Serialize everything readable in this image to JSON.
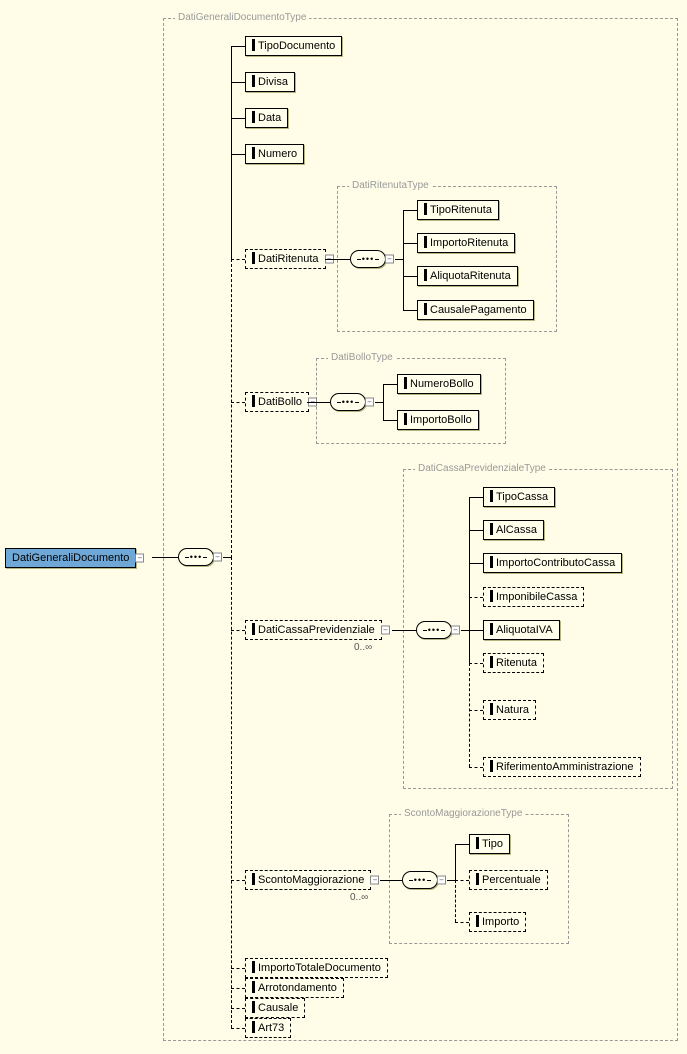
{
  "root": {
    "label": "DatiGeneraliDocumento"
  },
  "type_labels": {
    "main": "DatiGeneraliDocumentoType",
    "ritenuta": "DatiRitenutaType",
    "bollo": "DatiBolloType",
    "cassa": "DatiCassaPrevidenzialeType",
    "sconto": "ScontoMaggiorazioneType"
  },
  "children": {
    "tipoDocumento": "TipoDocumento",
    "divisa": "Divisa",
    "data": "Data",
    "numero": "Numero",
    "datiRitenuta": "DatiRitenuta",
    "datiBollo": "DatiBollo",
    "datiCassa": "DatiCassaPrevidenziale",
    "sconto": "ScontoMaggiorazione",
    "importoTotale": "ImportoTotaleDocumento",
    "arrotondamento": "Arrotondamento",
    "causale": "Causale",
    "art73": "Art73"
  },
  "ritenuta_children": {
    "tipo": "TipoRitenuta",
    "importo": "ImportoRitenuta",
    "aliquota": "AliquotaRitenuta",
    "causale": "CausalePagamento"
  },
  "bollo_children": {
    "numero": "NumeroBollo",
    "importo": "ImportoBollo"
  },
  "cassa_children": {
    "tipo": "TipoCassa",
    "al": "AlCassa",
    "importo": "ImportoContributoCassa",
    "imponibile": "ImponibileCassa",
    "aliquota": "AliquotaIVA",
    "ritenuta": "Ritenuta",
    "natura": "Natura",
    "riferimento": "RiferimentoAmministrazione"
  },
  "sconto_children": {
    "tipo": "Tipo",
    "percentuale": "Percentuale",
    "importo": "Importo"
  },
  "cardinality": {
    "unbounded": "0..∞"
  }
}
